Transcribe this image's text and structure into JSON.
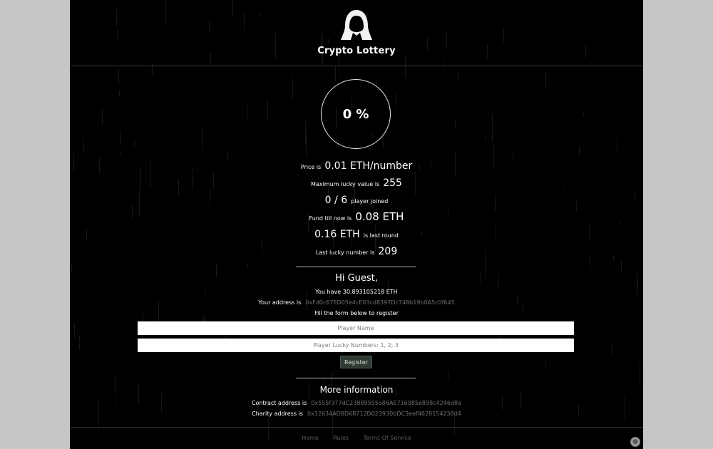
{
  "site": {
    "title": "Crypto Lottery"
  },
  "progress": {
    "label": "0 %",
    "value": 0
  },
  "stats": {
    "price_prefix": "Price is",
    "price_value": "0.01 ETH/number",
    "max_prefix": "Maximum lucky value is",
    "max_value": "255",
    "players_value": "0 / 6",
    "players_suffix": "player joined",
    "fund_prefix": "Fund till now is",
    "fund_value": "0.08 ETH",
    "last_round_value": "0.16 ETH",
    "last_round_suffix": "is last round",
    "last_lucky_prefix": "Last lucky number is",
    "last_lucky_value": "209"
  },
  "user": {
    "greeting": "Hi Guest,",
    "balance_text": "You have 30.893105218 ETH",
    "address_prefix": "Your address is",
    "address_value": "0xFd0c67ED05e4cE03cd8397Dc748b19b0A5c0f645",
    "form_hint": "Fill the form below to register"
  },
  "form": {
    "name_placeholder": "Player Name",
    "numbers_placeholder": "Player Lucky Numbers: 1, 2, 3",
    "register_label": "Register"
  },
  "more_info": {
    "title": "More information",
    "contract_prefix": "Contract address is",
    "contract_value": "0x555f377dC23889595a86AE716085e898c4246d8a",
    "charity_prefix": "Charity address is",
    "charity_value": "0x12634AD8D68712D023930bDC3eef4628154238d4"
  },
  "footer": {
    "links": [
      "Home",
      "Rules",
      "Terms Of Service"
    ]
  },
  "colors": {
    "page_bg": "#000000",
    "outer_bg": "#c6c6c6",
    "address_color": "#6f6f6f",
    "button_bg": "#2f3a33"
  }
}
